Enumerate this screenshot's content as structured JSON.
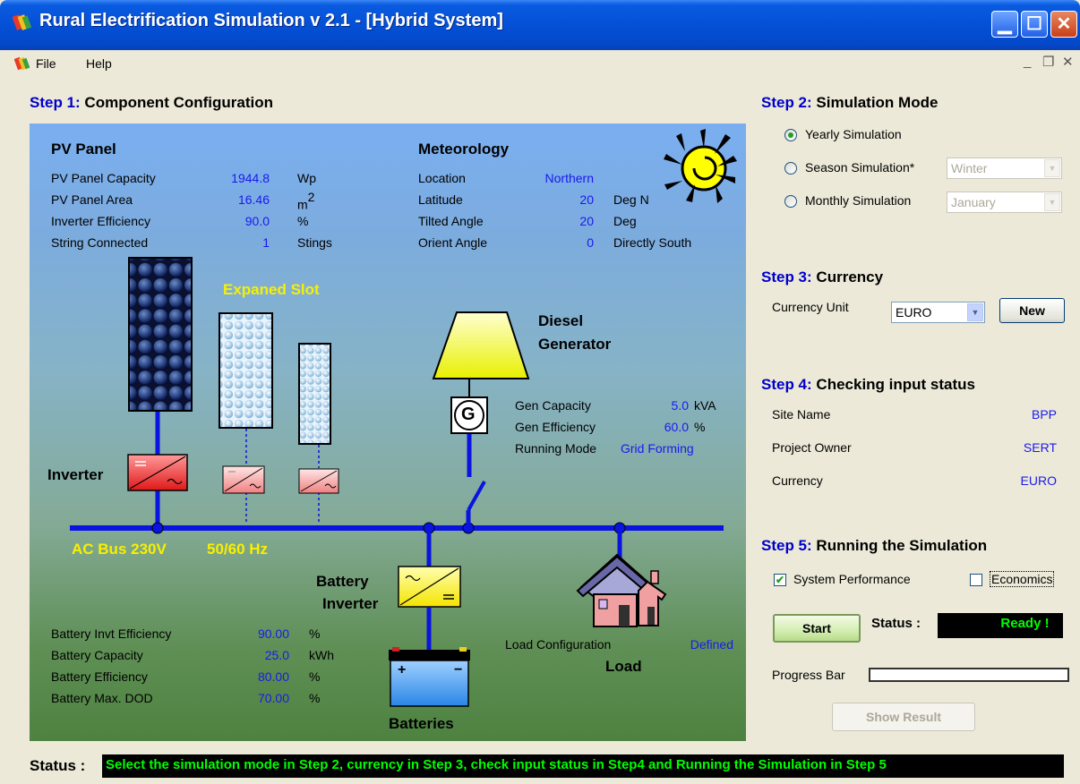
{
  "window": {
    "title": "Rural Electrification Simulation v 2.1 - [Hybrid System]"
  },
  "menu": {
    "items": [
      "File",
      "Help"
    ]
  },
  "step1": {
    "num": "Step 1:",
    "title": "Component Configuration"
  },
  "pv": {
    "title": "PV Panel",
    "rows": [
      {
        "label": "PV Panel Capacity",
        "value": "1944.8",
        "unit": "Wp"
      },
      {
        "label": "PV Panel Area",
        "value": "16.46",
        "unit": "m",
        "sup": "2"
      },
      {
        "label": "Inverter Efficiency",
        "value": "90.0",
        "unit": "%"
      },
      {
        "label": "String Connected",
        "value": "1",
        "unit": "Stings"
      }
    ]
  },
  "meteo": {
    "title": "Meteorology",
    "rows": [
      {
        "label": "Location",
        "value": "Northern",
        "unit": ""
      },
      {
        "label": "Latitude",
        "value": "20",
        "unit": "Deg N"
      },
      {
        "label": "Tilted Angle",
        "value": "20",
        "unit": "Deg"
      },
      {
        "label": "Orient Angle",
        "value": "0",
        "unit": "Directly South"
      }
    ]
  },
  "diagram": {
    "expanded_slot": "Expaned Slot",
    "diesel_line1": "Diesel",
    "diesel_line2": "Generator",
    "gen_symbol": "G",
    "inverter": "Inverter",
    "ac_bus": "AC Bus 230V",
    "ac_freq": "50/60 Hz",
    "battery_inverter_line1": "Battery",
    "battery_inverter_line2": "Inverter",
    "batteries": "Batteries",
    "load": "Load"
  },
  "generator": {
    "rows": [
      {
        "label": "Gen Capacity",
        "value": "5.0",
        "unit": "kVA"
      },
      {
        "label": "Gen Efficiency",
        "value": "60.0",
        "unit": "%"
      },
      {
        "label": "Running Mode",
        "value": "Grid Forming",
        "unit": ""
      }
    ]
  },
  "battery": {
    "rows": [
      {
        "label": "Battery Invt Efficiency",
        "value": "90.00",
        "unit": "%"
      },
      {
        "label": "Battery Capacity",
        "value": "25.0",
        "unit": "kWh"
      },
      {
        "label": "Battery Efficiency",
        "value": "80.00",
        "unit": "%"
      },
      {
        "label": "Battery Max. DOD",
        "value": "70.00",
        "unit": "%"
      }
    ]
  },
  "load_config": {
    "label": "Load Configuration",
    "value": "Defined"
  },
  "step2": {
    "num": "Step 2:",
    "title": "Simulation Mode",
    "options": [
      {
        "label": "Yearly Simulation",
        "selected": true
      },
      {
        "label": "Season Simulation*",
        "selected": false,
        "combo": "Winter"
      },
      {
        "label": "Monthly Simulation",
        "selected": false,
        "combo": "January"
      }
    ]
  },
  "step3": {
    "num": "Step 3:",
    "title": "Currency",
    "label": "Currency Unit",
    "value": "EURO",
    "new_button": "New"
  },
  "step4": {
    "num": "Step 4:",
    "title": "Checking input status",
    "rows": [
      {
        "label": "Site Name",
        "value": "BPP"
      },
      {
        "label": "Project Owner",
        "value": "SERT"
      },
      {
        "label": "Currency",
        "value": "EURO"
      }
    ]
  },
  "step5": {
    "num": "Step 5:",
    "title": "Running the Simulation",
    "system_performance": {
      "label": "System Performance",
      "checked": true
    },
    "economics": {
      "label": "Economics",
      "checked": false
    },
    "start_button": "Start",
    "status_label": "Status :",
    "status_value": "Ready !",
    "progress_label": "Progress Bar",
    "progress": 0,
    "show_result": "Show Result"
  },
  "statusbar": {
    "label": "Status :",
    "message": "Select the simulation mode in Step 2, currency in Step 3, check input status in Step4 and Running the Simulation in Step 5"
  },
  "colors": {
    "accent": "#0000cc",
    "value_blue": "#1a1aee",
    "bus_blue": "#0a14e0",
    "status_green": "#00ff00",
    "yellow_label": "#f8f000"
  }
}
